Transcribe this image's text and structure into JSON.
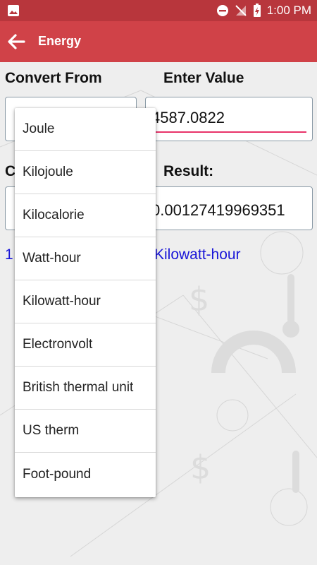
{
  "status_bar": {
    "time": "1:00 PM",
    "icons": [
      "gallery-icon",
      "do-not-disturb-icon",
      "no-signal-icon",
      "battery-icon"
    ]
  },
  "app_bar": {
    "title": "Energy",
    "back_icon": "arrow-left-icon"
  },
  "labels": {
    "convert_from": "Convert From",
    "enter_value": "Enter Value",
    "convert_to_partial": "C",
    "result": "Result:"
  },
  "input": {
    "value": "4587.0822"
  },
  "result": {
    "value": "0.00127419969351"
  },
  "summary": {
    "left_partial": "1",
    "right": "Kilowatt-hour"
  },
  "dropdown": {
    "items": [
      {
        "label": "Joule"
      },
      {
        "label": "Kilojoule"
      },
      {
        "label": "Kilocalorie"
      },
      {
        "label": "Watt-hour"
      },
      {
        "label": "Kilowatt-hour"
      },
      {
        "label": "Electronvolt"
      },
      {
        "label": "British thermal unit"
      },
      {
        "label": "US therm"
      },
      {
        "label": "Foot-pound"
      }
    ]
  },
  "colors": {
    "status_bar": "#b8363c",
    "app_bar": "#d04248",
    "accent_underline": "#e8336a",
    "link_text": "#1a16d8"
  }
}
